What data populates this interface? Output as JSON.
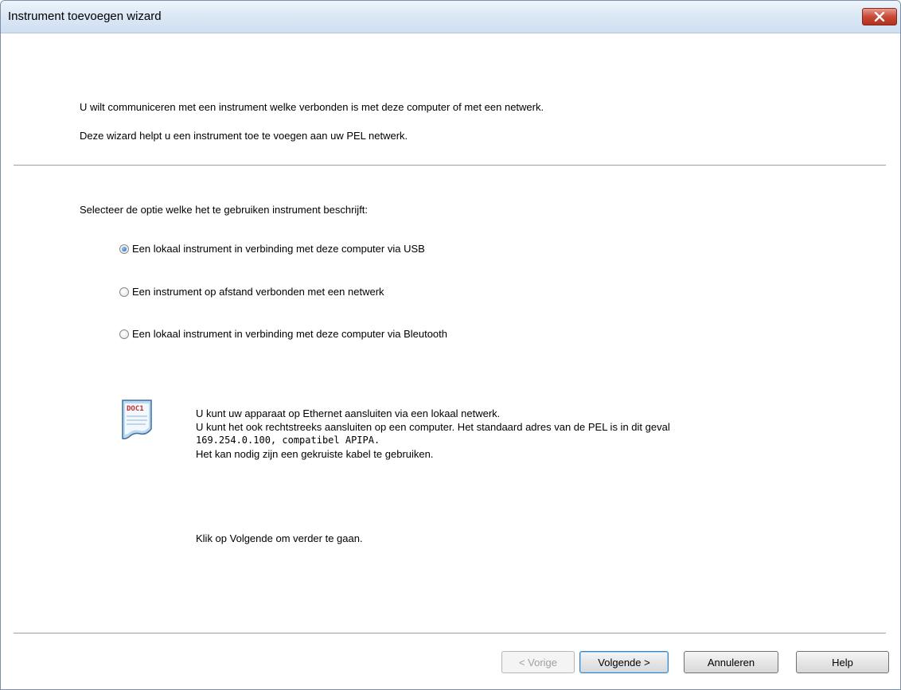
{
  "window": {
    "title": "Instrument toevoegen wizard"
  },
  "intro": {
    "line1": "U wilt communiceren met een instrument welke verbonden is met deze computer of met een netwerk.",
    "line2": "Deze wizard helpt u een instrument toe te voegen aan uw PEL netwerk."
  },
  "prompt": "Selecteer de optie welke het te gebruiken instrument beschrijft:",
  "options": [
    {
      "label": "Een lokaal instrument in verbinding met deze computer via USB",
      "checked": true
    },
    {
      "label": "Een instrument op afstand verbonden met een netwerk",
      "checked": false
    },
    {
      "label": "Een lokaal instrument in verbinding met deze computer via Bleutooth",
      "checked": false
    }
  ],
  "info": {
    "icon": "document-icon",
    "icon_text": "DOC1",
    "line1": "U kunt uw apparaat op Ethernet aansluiten via een lokaal netwerk.",
    "line2": "U kunt het ook rechtstreeks aansluiten op een computer. Het standaard adres van de PEL is in dit geval",
    "line3": "169.254.0.100, compatibel APIPA.",
    "line4": "Het kan nodig zijn een gekruiste kabel te gebruiken."
  },
  "footer_hint": "Klik op Volgende om verder te gaan.",
  "buttons": {
    "back": "< Vorige",
    "next": "Volgende >",
    "cancel": "Annuleren",
    "help": "Help"
  }
}
